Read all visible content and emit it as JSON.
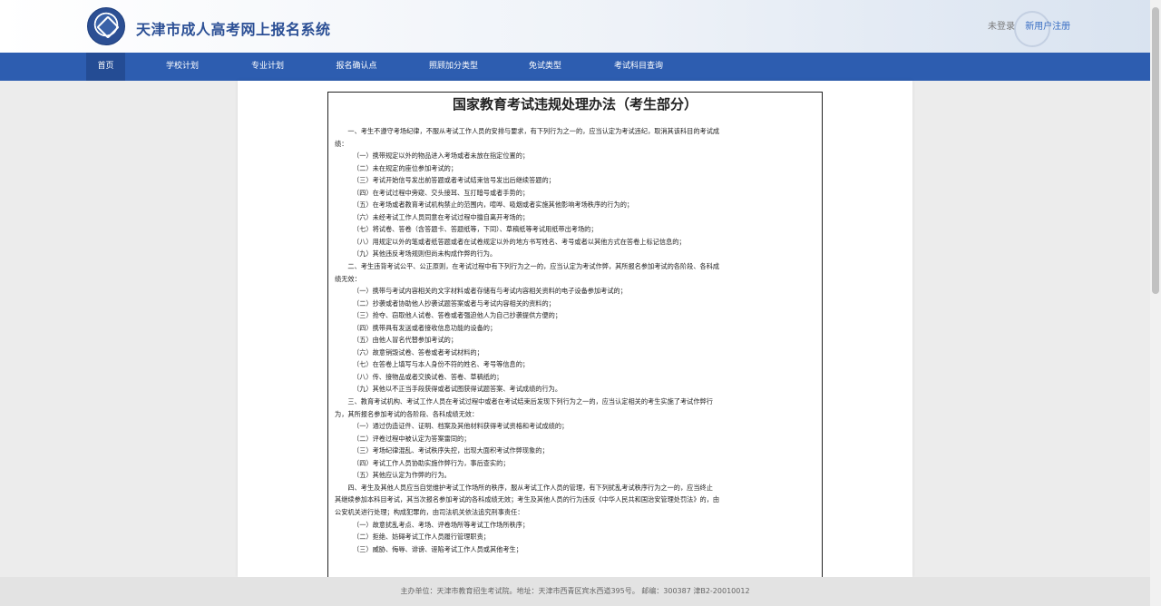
{
  "header": {
    "title": "天津市成人高考网上报名系统",
    "login_label": "未登录",
    "register_label": "新用户注册"
  },
  "nav": {
    "items": [
      {
        "label": "首页"
      },
      {
        "label": "学校计划"
      },
      {
        "label": "专业计划"
      },
      {
        "label": "报名确认点"
      },
      {
        "label": "照顾加分类型"
      },
      {
        "label": "免试类型"
      },
      {
        "label": "考试科目查询"
      }
    ]
  },
  "document": {
    "title": "国家教育考试违规处理办法（考生部分）",
    "lines": [
      {
        "text": "一、考生不遵守考场纪律，不服从考试工作人员的安排与要求，有下列行为之一的，应当认定为考试违纪，取消其该科目的考试成",
        "kind": "p"
      },
      {
        "text": "绩：",
        "kind": "c"
      },
      {
        "text": "（一）携带规定以外的物品进入考场或者未放在指定位置的；",
        "kind": "i"
      },
      {
        "text": "（二）未在规定的座位参加考试的；",
        "kind": "i"
      },
      {
        "text": "（三）考试开始信号发出前答题或者考试结束信号发出后继续答题的；",
        "kind": "i"
      },
      {
        "text": "（四）在考试过程中旁窥、交头接耳、互打暗号或者手势的；",
        "kind": "i"
      },
      {
        "text": "（五）在考场或者教育考试机构禁止的范围内，喧哗、吸烟或者实施其他影响考场秩序的行为的；",
        "kind": "i"
      },
      {
        "text": "（六）未经考试工作人员同意在考试过程中擅自离开考场的；",
        "kind": "i"
      },
      {
        "text": "（七）将试卷、答卷（含答题卡、答题纸等，下同）、草稿纸等考试用纸带出考场的；",
        "kind": "i"
      },
      {
        "text": "（八）用规定以外的笔或者纸答题或者在试卷规定以外的地方书写姓名、考号或者以其他方式在答卷上标记信息的；",
        "kind": "i"
      },
      {
        "text": "（九）其他违反考场规则但尚未构成作弊的行为。",
        "kind": "i"
      },
      {
        "text": "二、考生违背考试公平、公正原则，在考试过程中有下列行为之一的，应当认定为考试作弊，其所报名参加考试的各阶段、各科成",
        "kind": "p"
      },
      {
        "text": "绩无效：",
        "kind": "c"
      },
      {
        "text": "（一）携带与考试内容相关的文字材料或者存储有与考试内容相关资料的电子设备参加考试的；",
        "kind": "i"
      },
      {
        "text": "（二）抄袭或者协助他人抄袭试题答案或者与考试内容相关的资料的；",
        "kind": "i"
      },
      {
        "text": "（三）抢夺、窃取他人试卷、答卷或者强迫他人为自己抄袭提供方便的；",
        "kind": "i"
      },
      {
        "text": "（四）携带具有发送或者接收信息功能的设备的；",
        "kind": "i"
      },
      {
        "text": "（五）由他人冒名代替参加考试的；",
        "kind": "i"
      },
      {
        "text": "（六）故意销毁试卷、答卷或者考试材料的；",
        "kind": "i"
      },
      {
        "text": "（七）在答卷上填写与本人身份不符的姓名、考号等信息的；",
        "kind": "i"
      },
      {
        "text": "（八）传、接物品或者交换试卷、答卷、草稿纸的；",
        "kind": "i"
      },
      {
        "text": "（九）其他以不正当手段获得或者试图获得试题答案、考试成绩的行为。",
        "kind": "i"
      },
      {
        "text": "三、教育考试机构、考试工作人员在考试过程中或者在考试结束后发现下列行为之一的，应当认定相关的考生实施了考试作弊行",
        "kind": "p"
      },
      {
        "text": "为，其所报名参加考试的各阶段、各科成绩无效：",
        "kind": "c"
      },
      {
        "text": "（一）通过伪造证件、证明、档案及其他材料获得考试资格和考试成绩的；",
        "kind": "i"
      },
      {
        "text": "（二）评卷过程中被认定为答案雷同的；",
        "kind": "i"
      },
      {
        "text": "（三）考场纪律混乱、考试秩序失控，出现大面积考试作弊现象的；",
        "kind": "i"
      },
      {
        "text": "（四）考试工作人员协助实施作弊行为，事后查实的；",
        "kind": "i"
      },
      {
        "text": "（五）其他应认定为作弊的行为。",
        "kind": "i"
      },
      {
        "text": "四、考生及其他人员应当自觉维护考试工作场所的秩序，服从考试工作人员的管理，有下列扰乱考试秩序行为之一的，应当终止",
        "kind": "p"
      },
      {
        "text": "其继续参加本科目考试，其当次报名参加考试的各科成绩无效；考生及其他人员的行为违反《中华人民共和国治安管理处罚法》的，由",
        "kind": "c"
      },
      {
        "text": "公安机关进行处理；构成犯罪的，由司法机关依法追究刑事责任：",
        "kind": "c"
      },
      {
        "text": "（一）故意扰乱考点、考场、评卷场所等考试工作场所秩序；",
        "kind": "i"
      },
      {
        "text": "（二）拒绝、妨碍考试工作人员履行管理职责；",
        "kind": "i"
      },
      {
        "text": "（三）威胁、侮辱、诽谤、诬陷考试工作人员或其他考生；",
        "kind": "i"
      }
    ]
  },
  "footer": {
    "text": "主办单位：天津市教育招生考试院。地址：天津市西青区宾水西道395号。 邮编：300387 津B2-20010012"
  }
}
